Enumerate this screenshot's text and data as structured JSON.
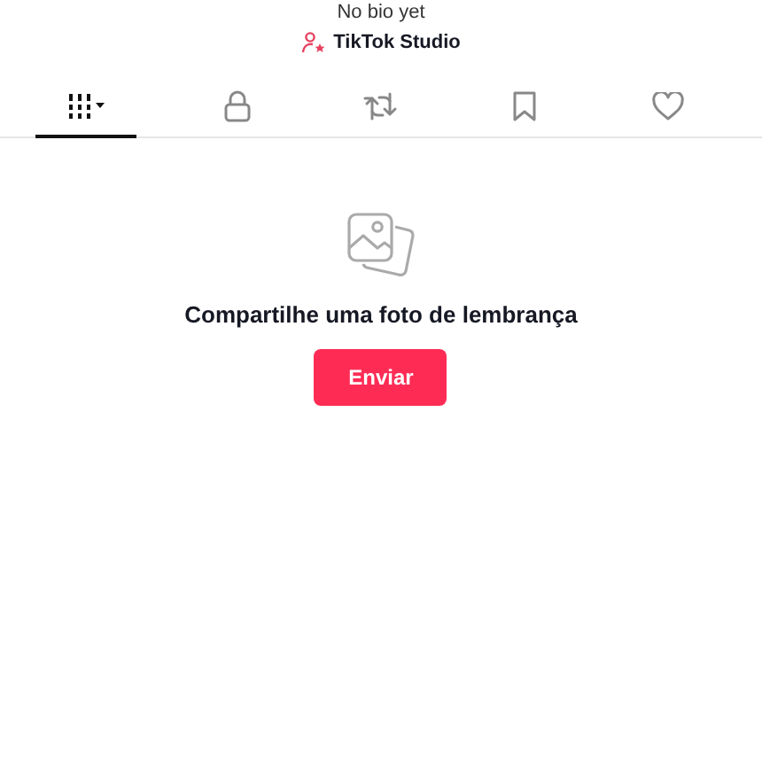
{
  "profile": {
    "bio": "No bio yet",
    "studio_link": "TikTok Studio"
  },
  "tabs": [
    {
      "kind": "grid",
      "selected": true
    },
    {
      "kind": "lock",
      "selected": false
    },
    {
      "kind": "repost",
      "selected": false
    },
    {
      "kind": "bookmark",
      "selected": false
    },
    {
      "kind": "heart",
      "selected": false
    }
  ],
  "empty_state": {
    "message": "Compartilhe uma foto de lembrança",
    "button": "Enviar"
  }
}
